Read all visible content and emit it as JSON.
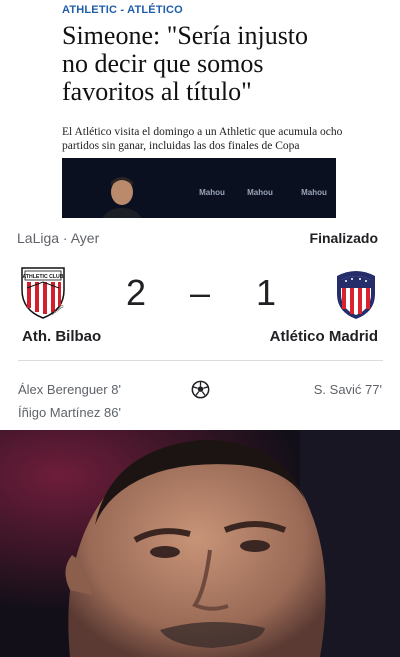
{
  "article": {
    "kicker": "ATHLETIC - ATLÉTICO",
    "headline_lines": [
      "Simeone: \"Sería injusto",
      "no decir que somos",
      "favoritos al título\""
    ],
    "lede_lines": [
      "El Atlético visita el domingo a un Athletic que acumula ocho",
      "partidos sin ganar, incluidas las dos finales de Copa"
    ],
    "ad_boards": [
      "Mahou",
      "Mahou",
      "Mahou"
    ]
  },
  "match": {
    "competition": "LaLiga · Ayer",
    "status": "Finalizado",
    "home": {
      "name": "Ath. Bilbao",
      "score": "2",
      "crest_text_top": "ATHLETIC CLUB",
      "crest_text_bottom": "BILBAO"
    },
    "separator": "–",
    "away": {
      "name": "Atlético Madrid",
      "score": "1"
    },
    "home_scorers": [
      "Álex Berenguer 8'",
      "Íñigo Martínez 86'"
    ],
    "away_scorers": [
      "S. Savić 77'"
    ]
  },
  "colors": {
    "kicker": "#1f5ea8",
    "athletic_red": "#d11f2e",
    "atletico_red": "#d9232e",
    "atletico_blue": "#252d6b"
  }
}
